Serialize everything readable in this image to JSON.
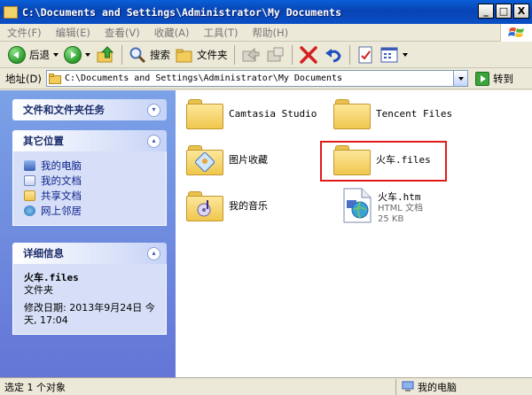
{
  "window": {
    "title": "C:\\Documents and Settings\\Administrator\\My Documents",
    "minimize": "_",
    "maximize": "□",
    "close": "X"
  },
  "menu": [
    "文件(F)",
    "编辑(E)",
    "查看(V)",
    "收藏(A)",
    "工具(T)",
    "帮助(H)"
  ],
  "toolbar": {
    "back": "后退",
    "search": "搜索",
    "folders": "文件夹"
  },
  "address": {
    "label": "地址(D)",
    "value": "C:\\Documents and Settings\\Administrator\\My Documents",
    "go": "转到"
  },
  "tasks": {
    "title": "文件和文件夹任务"
  },
  "places": {
    "title": "其它位置",
    "items": [
      {
        "label": "我的电脑",
        "icon": "computer-icon"
      },
      {
        "label": "我的文档",
        "icon": "documents-icon"
      },
      {
        "label": "共享文档",
        "icon": "shared-folder-icon"
      },
      {
        "label": "网上邻居",
        "icon": "network-icon"
      }
    ]
  },
  "details": {
    "title": "详细信息",
    "name": "火车.files",
    "type": "文件夹",
    "modified": "修改日期: 2013年9月24日 今天, 17:04"
  },
  "files": [
    {
      "name": "Camtasia Studio",
      "icon": "folder-icon"
    },
    {
      "name": "Tencent Files",
      "icon": "folder-icon"
    },
    {
      "name": "图片收藏",
      "icon": "pictures-folder-icon"
    },
    {
      "name": "火车.files",
      "icon": "folder-icon"
    },
    {
      "name": "我的音乐",
      "icon": "music-folder-icon"
    },
    {
      "name": "火车.htm",
      "type": "HTML 文档",
      "size": "25 KB",
      "icon": "html-document-icon"
    }
  ],
  "status": {
    "left": "选定 1 个对象",
    "right": "我的电脑"
  },
  "colors": {
    "title_bar": "#0a5fd8",
    "task_pane": "#6d8ce0",
    "highlight": "#e31a1a"
  }
}
